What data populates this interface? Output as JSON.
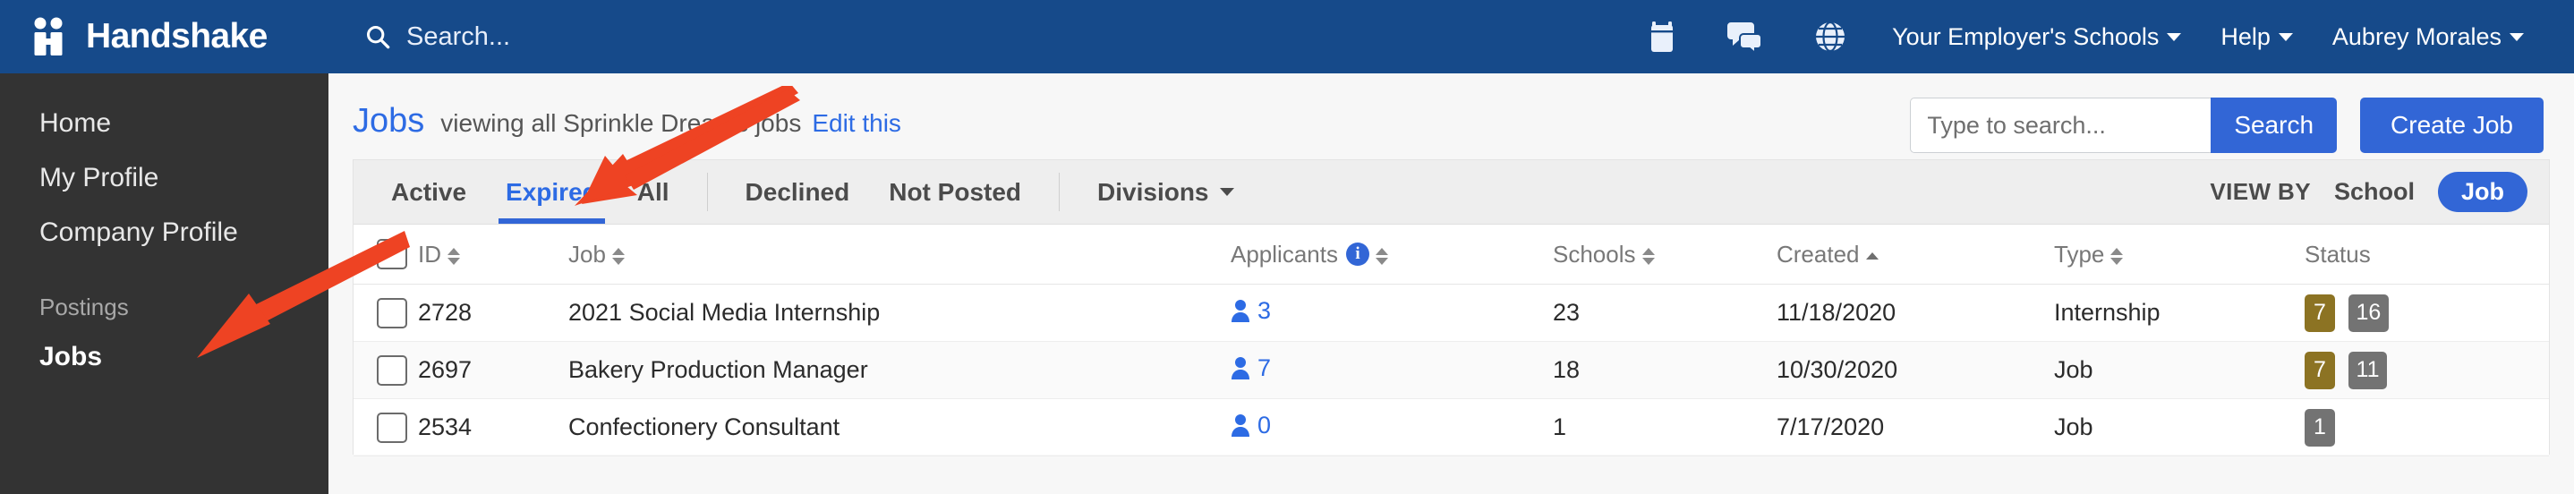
{
  "topnav": {
    "brand": "Handshake",
    "search_placeholder": "Search...",
    "icons": [
      "calendar-icon",
      "chat-icon",
      "globe-icon"
    ],
    "links": [
      {
        "label": "Your Employer's Schools",
        "caret": true
      },
      {
        "label": "Help",
        "caret": true
      },
      {
        "label": "Aubrey Morales",
        "caret": true
      }
    ]
  },
  "sidebar": {
    "items": [
      {
        "label": "Home",
        "active": false
      },
      {
        "label": "My Profile",
        "active": false
      },
      {
        "label": "Company Profile",
        "active": false
      }
    ],
    "section_label": "Postings",
    "section_items": [
      {
        "label": "Jobs",
        "active": true
      }
    ]
  },
  "header": {
    "title": "Jobs",
    "subtitle": "viewing all Sprinkle Dreams jobs",
    "edit_link": "Edit this",
    "search_placeholder": "Type to search...",
    "search_value": "",
    "search_button": "Search",
    "create_button": "Create Job"
  },
  "tabs": [
    {
      "label": "Active",
      "active": false
    },
    {
      "label": "Expired",
      "active": true
    },
    {
      "label": "All",
      "active": false
    },
    {
      "label": "Declined",
      "active": false
    },
    {
      "label": "Not Posted",
      "active": false
    },
    {
      "label": "Divisions",
      "active": false,
      "caret": true
    }
  ],
  "viewby": {
    "label": "VIEW BY",
    "options": [
      {
        "label": "School",
        "selected": false
      },
      {
        "label": "Job",
        "selected": true
      }
    ]
  },
  "table": {
    "columns": [
      {
        "label": "ID",
        "sort": "both"
      },
      {
        "label": "Job",
        "sort": "both"
      },
      {
        "label": "Applicants",
        "sort": "both",
        "info": true
      },
      {
        "label": "Schools",
        "sort": "both"
      },
      {
        "label": "Created",
        "sort": "asc"
      },
      {
        "label": "Type",
        "sort": "both"
      },
      {
        "label": "Status",
        "sort": "none"
      }
    ],
    "rows": [
      {
        "id": "2728",
        "job": "2021 Social Media Internship",
        "applicants": "3",
        "schools": "23",
        "created": "11/18/2020",
        "type": "Internship",
        "status": [
          {
            "value": "7",
            "color": "#8C7323"
          },
          {
            "value": "16",
            "color": "#737373"
          }
        ]
      },
      {
        "id": "2697",
        "job": "Bakery Production Manager",
        "applicants": "7",
        "schools": "18",
        "created": "10/30/2020",
        "type": "Job",
        "status": [
          {
            "value": "7",
            "color": "#8C7323"
          },
          {
            "value": "11",
            "color": "#737373"
          }
        ]
      },
      {
        "id": "2534",
        "job": "Confectionery Consultant",
        "applicants": "0",
        "schools": "1",
        "created": "7/17/2020",
        "type": "Job",
        "status": [
          {
            "value": "1",
            "color": "#737373"
          }
        ]
      }
    ]
  },
  "annotations": {
    "arrow_color": "#EE4323",
    "arrows": [
      {
        "name": "arrow-to-expired-tab"
      },
      {
        "name": "arrow-to-jobs-sidebar"
      }
    ]
  },
  "colors": {
    "navbar": "#164A8A",
    "sidebar": "#333333",
    "accent_blue": "#3266D6",
    "link_blue": "#2D6BE4",
    "page_bg": "#f7f7f7"
  }
}
